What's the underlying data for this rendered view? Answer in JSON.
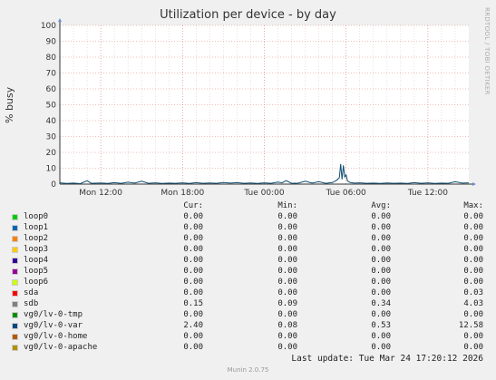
{
  "chart_data": {
    "type": "line",
    "title": "Utilization per device - by day",
    "ylabel": "% busy",
    "watermark": "RRDTOOL / TOBI OETIKER",
    "ylim": [
      0,
      100
    ],
    "yticks": [
      0,
      10,
      20,
      30,
      40,
      50,
      60,
      70,
      80,
      90,
      100
    ],
    "xlim_hours": [
      0,
      30
    ],
    "xticks": [
      {
        "label": "Mon 12:00",
        "hour": 3
      },
      {
        "label": "Mon 18:00",
        "hour": 9
      },
      {
        "label": "Tue 00:00",
        "hour": 15
      },
      {
        "label": "Tue 06:00",
        "hour": 21
      },
      {
        "label": "Tue 12:00",
        "hour": 27
      }
    ],
    "grid": true,
    "series_line": {
      "name": "vg0/lv-0-var",
      "color": "#0d4d70",
      "points": [
        [
          0,
          0.8
        ],
        [
          0.5,
          0.4
        ],
        [
          1,
          0.6
        ],
        [
          1.5,
          0.3
        ],
        [
          2,
          2.1
        ],
        [
          2.3,
          0.5
        ],
        [
          3,
          0.7
        ],
        [
          3.5,
          0.4
        ],
        [
          4,
          0.9
        ],
        [
          4.5,
          0.5
        ],
        [
          5,
          1.2
        ],
        [
          5.5,
          0.6
        ],
        [
          6,
          1.8
        ],
        [
          6.5,
          0.5
        ],
        [
          7,
          0.8
        ],
        [
          7.5,
          0.4
        ],
        [
          8,
          0.6
        ],
        [
          8.5,
          0.5
        ],
        [
          9,
          0.8
        ],
        [
          9.5,
          0.4
        ],
        [
          10,
          0.9
        ],
        [
          10.5,
          0.5
        ],
        [
          11,
          0.7
        ],
        [
          11.5,
          0.5
        ],
        [
          12,
          1.0
        ],
        [
          12.5,
          0.6
        ],
        [
          13,
          0.9
        ],
        [
          13.5,
          0.5
        ],
        [
          14,
          0.7
        ],
        [
          14.5,
          0.4
        ],
        [
          15,
          0.8
        ],
        [
          15.5,
          0.5
        ],
        [
          16,
          1.3
        ],
        [
          16.3,
          0.8
        ],
        [
          16.6,
          2.2
        ],
        [
          17,
          0.5
        ],
        [
          17.5,
          0.6
        ],
        [
          18,
          1.8
        ],
        [
          18.5,
          0.6
        ],
        [
          19,
          1.5
        ],
        [
          19.5,
          0.5
        ],
        [
          20,
          1.0
        ],
        [
          20.3,
          2.4
        ],
        [
          20.5,
          4.0
        ],
        [
          20.6,
          12.6
        ],
        [
          20.7,
          3.0
        ],
        [
          20.8,
          11.8
        ],
        [
          20.9,
          4.5
        ],
        [
          21,
          5.8
        ],
        [
          21.1,
          2.0
        ],
        [
          21.3,
          1.0
        ],
        [
          21.6,
          0.6
        ],
        [
          22,
          0.8
        ],
        [
          22.5,
          0.5
        ],
        [
          23,
          0.6
        ],
        [
          23.5,
          0.4
        ],
        [
          24,
          0.7
        ],
        [
          24.5,
          0.5
        ],
        [
          25,
          0.6
        ],
        [
          25.5,
          0.4
        ],
        [
          26,
          0.9
        ],
        [
          26.5,
          0.5
        ],
        [
          27,
          0.8
        ],
        [
          27.5,
          0.4
        ],
        [
          28,
          0.6
        ],
        [
          28.5,
          0.5
        ],
        [
          29,
          1.5
        ],
        [
          29.5,
          0.6
        ],
        [
          30,
          0.8
        ]
      ]
    },
    "legend_headers": {
      "cur": "Cur:",
      "min": "Min:",
      "avg": "Avg:",
      "max": "Max:"
    },
    "legend": [
      {
        "name": "loop0",
        "color": "#00cc00",
        "cur": "0.00",
        "min": "0.00",
        "avg": "0.00",
        "max": "0.00"
      },
      {
        "name": "loop1",
        "color": "#0066b3",
        "cur": "0.00",
        "min": "0.00",
        "avg": "0.00",
        "max": "0.00"
      },
      {
        "name": "loop2",
        "color": "#ff8000",
        "cur": "0.00",
        "min": "0.00",
        "avg": "0.00",
        "max": "0.00"
      },
      {
        "name": "loop3",
        "color": "#ffcc00",
        "cur": "0.00",
        "min": "0.00",
        "avg": "0.00",
        "max": "0.00"
      },
      {
        "name": "loop4",
        "color": "#330099",
        "cur": "0.00",
        "min": "0.00",
        "avg": "0.00",
        "max": "0.00"
      },
      {
        "name": "loop5",
        "color": "#990099",
        "cur": "0.00",
        "min": "0.00",
        "avg": "0.00",
        "max": "0.00"
      },
      {
        "name": "loop6",
        "color": "#ccff00",
        "cur": "0.00",
        "min": "0.00",
        "avg": "0.00",
        "max": "0.00"
      },
      {
        "name": "sda",
        "color": "#ff0000",
        "cur": "0.00",
        "min": "0.00",
        "avg": "0.00",
        "max": "0.03"
      },
      {
        "name": "sdb",
        "color": "#808080",
        "cur": "0.15",
        "min": "0.09",
        "avg": "0.34",
        "max": "4.03"
      },
      {
        "name": "vg0/lv-0-tmp",
        "color": "#008f00",
        "cur": "0.00",
        "min": "0.00",
        "avg": "0.00",
        "max": "0.00"
      },
      {
        "name": "vg0/lv-0-var",
        "color": "#00487d",
        "cur": "2.40",
        "min": "0.08",
        "avg": "0.53",
        "max": "12.58"
      },
      {
        "name": "vg0/lv-0-home",
        "color": "#b35a00",
        "cur": "0.00",
        "min": "0.00",
        "avg": "0.00",
        "max": "0.00"
      },
      {
        "name": "vg0/lv-0-apache",
        "color": "#b38f00",
        "cur": "0.00",
        "min": "0.00",
        "avg": "0.00",
        "max": "0.00"
      }
    ]
  },
  "last_update": "Last update: Tue Mar 24 17:20:12 2026",
  "footer": "Munin 2.0.75"
}
